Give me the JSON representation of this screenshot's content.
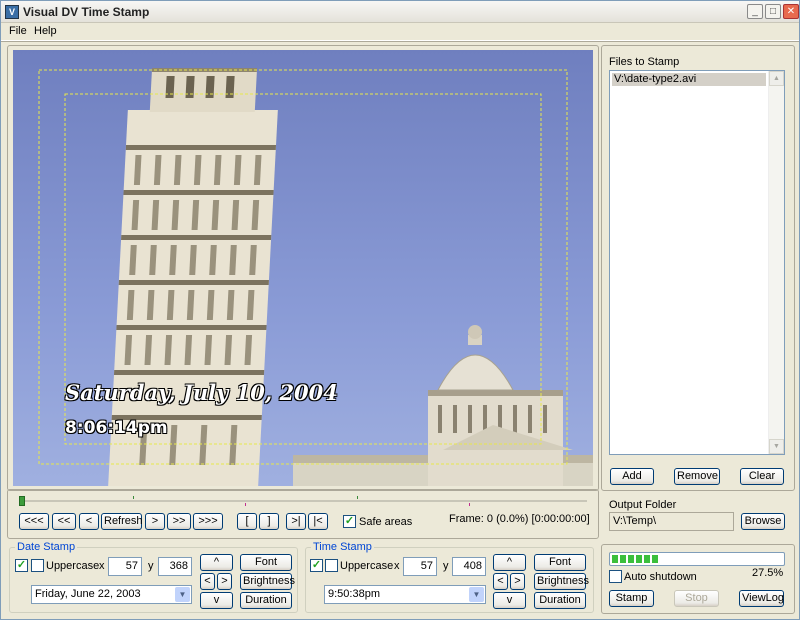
{
  "window": {
    "title": "Visual DV Time Stamp",
    "icon_text": "V"
  },
  "menu": {
    "file": "File",
    "help": "Help"
  },
  "preview": {
    "date_overlay": "Saturday, July 10, 2004",
    "time_overlay": "8:06:14pm"
  },
  "nav": {
    "b_start": "<<<",
    "b_back_big": "<<",
    "b_back": "<",
    "refresh": "Refresh",
    "b_fwd": ">",
    "b_fwd_big": ">>",
    "b_end": ">>>",
    "mark_in": "[",
    "mark_out": "]",
    "go_out": ">|",
    "go_in": "|<",
    "safe_areas": "Safe areas",
    "frame_info": "Frame: 0 (0.0%) [0:00:00:00]"
  },
  "files": {
    "label": "Files to Stamp",
    "items": [
      "V:\\date-type2.avi"
    ],
    "add": "Add",
    "remove": "Remove",
    "clear": "Clear"
  },
  "output": {
    "label": "Output Folder",
    "path": "V:\\Temp\\",
    "browse": "Browse"
  },
  "date_stamp": {
    "label": "Date Stamp",
    "uppercase": "Uppercase",
    "x_label": "x",
    "x": "57",
    "y_label": "y",
    "y": "368",
    "format": "Friday, June 22, 2003",
    "up": "^",
    "left": "<",
    "right": ">",
    "down": "v",
    "font": "Font",
    "brightness": "Brightness",
    "duration": "Duration"
  },
  "time_stamp": {
    "label": "Time Stamp",
    "uppercase": "Uppercase",
    "x_label": "x",
    "x": "57",
    "y_label": "y",
    "y": "408",
    "format": "9:50:38pm",
    "up": "^",
    "left": "<",
    "right": ">",
    "down": "v",
    "font": "Font",
    "brightness": "Brightness",
    "duration": "Duration"
  },
  "progress_panel": {
    "progress": 0.275,
    "percent": "27.5%",
    "auto_shutdown": "Auto shutdown",
    "stamp": "Stamp",
    "stop": "Stop",
    "viewlog": "ViewLog"
  },
  "icons": [
    "minimize-icon",
    "maximize-icon",
    "close-icon",
    "checkmark-icon",
    "dropdown-arrow-icon",
    "scroll-up-icon",
    "scroll-down-icon"
  ]
}
